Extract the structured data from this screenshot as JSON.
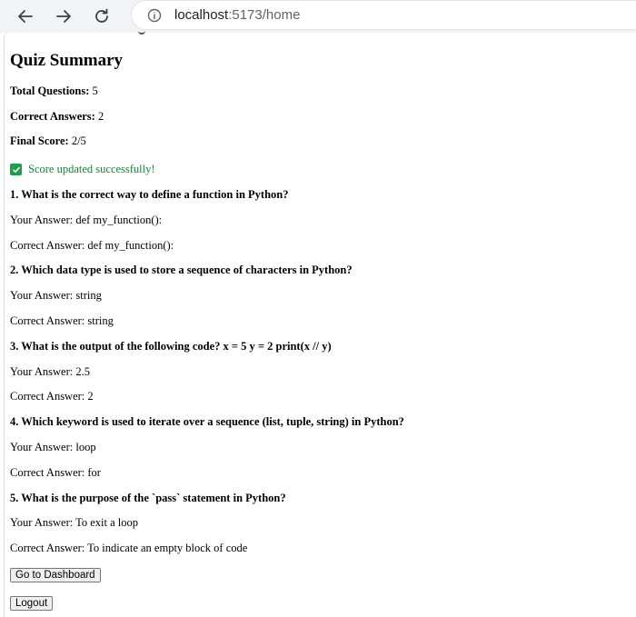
{
  "browser": {
    "url_host": "localhost",
    "url_rest": ":5173/home"
  },
  "summary": {
    "title": "Quiz Summary",
    "total_label": "Total Questions:",
    "total_value": " 5",
    "correct_label": "Correct Answers:",
    "correct_value": " 2",
    "score_label": "Final Score:",
    "score_value": " 2/5",
    "status_message": "Score updated successfully!"
  },
  "questions": [
    {
      "question": "1. What is the correct way to define a function in Python?",
      "your_answer": "Your Answer: def my_function():",
      "correct_answer": "Correct Answer: def my_function():"
    },
    {
      "question": "2. Which data type is used to store a sequence of characters in Python?",
      "your_answer": "Your Answer: string",
      "correct_answer": "Correct Answer: string"
    },
    {
      "question": "3. What is the output of the following code? x = 5 y = 2 print(x // y)",
      "your_answer": "Your Answer: 2.5",
      "correct_answer": "Correct Answer: 2"
    },
    {
      "question": "4. Which keyword is used to iterate over a sequence (list, tuple, string) in Python?",
      "your_answer": "Your Answer: loop",
      "correct_answer": "Correct Answer: for"
    },
    {
      "question": "5. What is the purpose of the `pass` statement in Python?",
      "your_answer": "Your Answer: To exit a loop",
      "correct_answer": "Correct Answer: To indicate an empty block of code"
    }
  ],
  "actions": {
    "dashboard_label": "Go to Dashboard",
    "logout_label": "Logout"
  }
}
